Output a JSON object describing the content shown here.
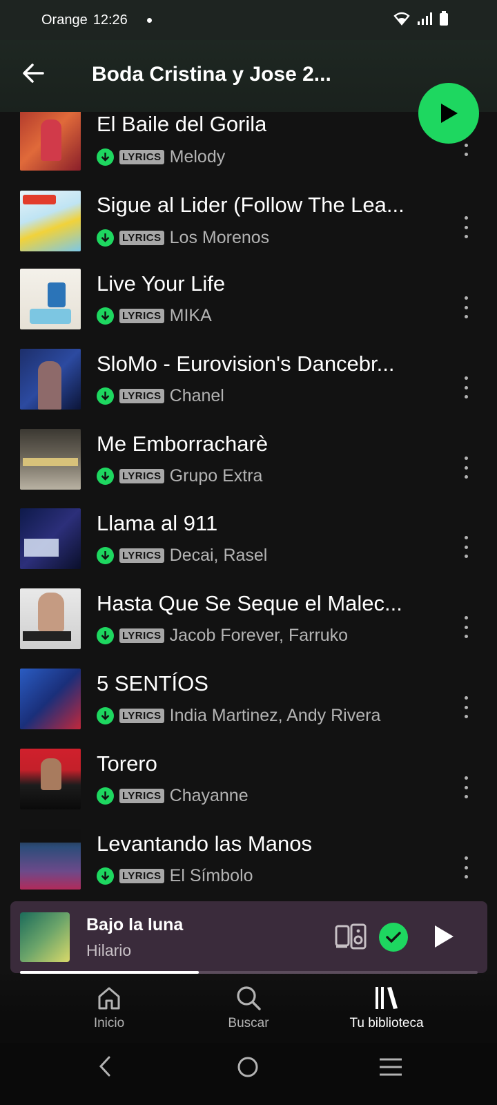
{
  "status_bar": {
    "carrier": "Orange",
    "time": "12:26"
  },
  "header": {
    "title": "Boda Cristina y Jose 2..."
  },
  "tracks": [
    {
      "title": "El Baile del Gorila",
      "badge": "LYRICS",
      "artist": "Melody"
    },
    {
      "title": "Sigue al Lider (Follow The Lea...",
      "badge": "LYRICS",
      "artist": "Los Morenos"
    },
    {
      "title": "Live Your Life",
      "badge": "LYRICS",
      "artist": "MIKA"
    },
    {
      "title": "SloMo - Eurovision's Dancebr...",
      "badge": "LYRICS",
      "artist": "Chanel"
    },
    {
      "title": "Me Emborracharè",
      "badge": "LYRICS",
      "artist": "Grupo Extra"
    },
    {
      "title": "Llama al 911",
      "badge": "LYRICS",
      "artist": "Decai, Rasel"
    },
    {
      "title": "Hasta Que Se Seque el Malec...",
      "badge": "LYRICS",
      "artist": "Jacob Forever, Farruko"
    },
    {
      "title": "5 SENTÍOS",
      "badge": "LYRICS",
      "artist": "India Martinez, Andy Rivera"
    },
    {
      "title": "Torero",
      "badge": "LYRICS",
      "artist": "Chayanne"
    },
    {
      "title": "Levantando las Manos",
      "badge": "LYRICS",
      "artist": "El Símbolo"
    }
  ],
  "now_playing": {
    "title": "Bajo la luna",
    "artist": "Hilario",
    "progress": 0.39
  },
  "bottom_nav": [
    {
      "label": "Inicio",
      "icon": "home-icon"
    },
    {
      "label": "Buscar",
      "icon": "search-icon"
    },
    {
      "label": "Tu biblioteca",
      "icon": "library-icon",
      "active": true
    }
  ],
  "colors": {
    "accent": "#1ed760",
    "background": "#121212",
    "mini_player": "#3a2b3b"
  }
}
